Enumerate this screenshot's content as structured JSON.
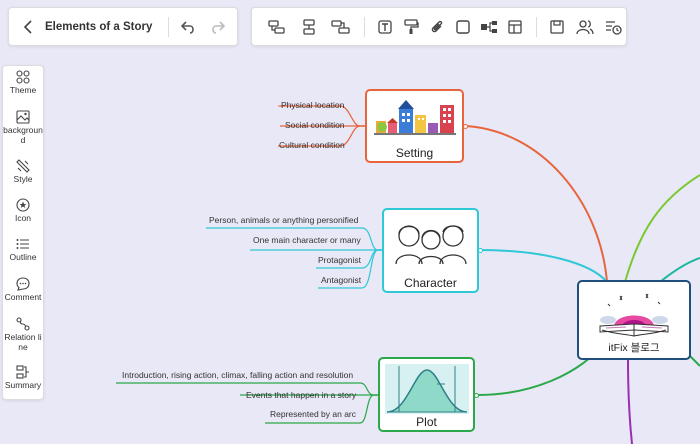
{
  "header": {
    "title": "Elements of a Story",
    "back_icon": "chevron-left-icon",
    "undo_icon": "undo-icon",
    "redo_icon": "redo-icon"
  },
  "toolbar": {
    "icons": [
      "insert-topic-icon",
      "insert-subtopic-icon",
      "insert-floating-topic-icon",
      "text-icon",
      "format-painter-icon",
      "attachment-icon",
      "shape-icon",
      "connector-icon",
      "layout-icon",
      "save-icon",
      "collaborate-icon",
      "history-icon"
    ]
  },
  "sidebar": {
    "items": [
      {
        "label": "Theme",
        "icon": "theme-grid-icon"
      },
      {
        "label": "background",
        "icon": "background-image-icon"
      },
      {
        "label": "Style",
        "icon": "style-brush-icon"
      },
      {
        "label": "Icon",
        "icon": "star-circle-icon"
      },
      {
        "label": "Outline",
        "icon": "outline-list-icon"
      },
      {
        "label": "Comment",
        "icon": "comment-icon"
      },
      {
        "label": "Relation line",
        "icon": "relation-line-icon"
      },
      {
        "label": "Summary",
        "icon": "summary-icon"
      }
    ]
  },
  "mindmap": {
    "center": {
      "title": "itFix 블로그"
    },
    "setting": {
      "title": "Setting",
      "color": "#e8643c",
      "children": [
        "Physical location",
        "Social condition",
        "Cultural condition"
      ]
    },
    "character": {
      "title": "Character",
      "color": "#2ec8d6",
      "children": [
        "Person, animals or anything personified",
        "One main character or many",
        "Protagonist",
        "Antagonist"
      ]
    },
    "plot": {
      "title": "Plot",
      "color": "#2aa84a",
      "children": [
        "Introduction, rising action, climax, falling action and resolution",
        "Events that happen in a story",
        "Represented by an arc"
      ]
    }
  },
  "colors": {
    "canvas_bg": "#e8e8f6",
    "center_border": "#1f4f7a",
    "branch_purple": "#9b2fb0",
    "branch_green": "#7cc832",
    "branch_teal": "#1fb7a0"
  }
}
